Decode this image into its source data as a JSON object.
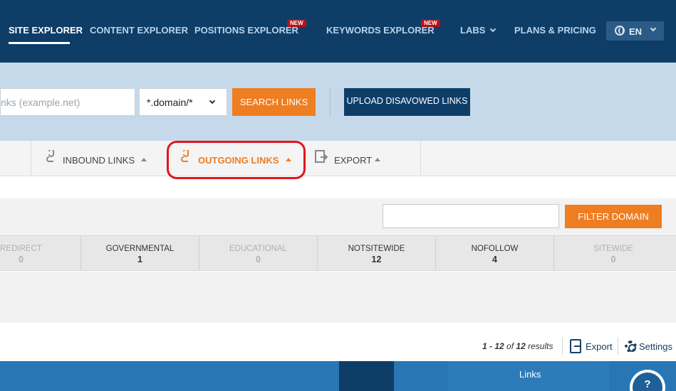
{
  "nav": {
    "items": [
      {
        "label": "SITE EXPLORER"
      },
      {
        "label": "CONTENT EXPLORER"
      },
      {
        "label": "POSITIONS EXPLORER",
        "badge": "NEW"
      },
      {
        "label": "KEYWORDS EXPLORER",
        "badge": "NEW"
      },
      {
        "label": "LABS"
      },
      {
        "label": "PLANS & PRICING"
      }
    ],
    "active": "SITE EXPLORER",
    "language": "EN"
  },
  "search": {
    "url_placeholder": "nks (example.net)",
    "mode_value": "*.domain/*",
    "search_button": "SEARCH LINKS",
    "upload_button": "UPLOAD DISAVOWED LINKS"
  },
  "tabs": [
    {
      "label": "INBOUND LINKS",
      "icon": "link-icon"
    },
    {
      "label": "OUTGOING LINKS",
      "icon": "link-icon",
      "active": true
    },
    {
      "label": "EXPORT",
      "icon": "export-icon"
    }
  ],
  "filter": {
    "input_value": "",
    "button": "FILTER DOMAIN"
  },
  "stats": [
    {
      "name": "REDIRECT",
      "value": "0"
    },
    {
      "name": "GOVERNMENTAL",
      "value": "1"
    },
    {
      "name": "EDUCATIONAL",
      "value": "0"
    },
    {
      "name": "NOTSITEWIDE",
      "value": "12"
    },
    {
      "name": "NOFOLLOW",
      "value": "4"
    },
    {
      "name": "SITEWIDE",
      "value": "0"
    }
  ],
  "results": {
    "range": "1 - 12",
    "of_label": "of",
    "total": "12",
    "suffix": "results",
    "export_label": "Export",
    "settings_label": "Settings"
  },
  "bottom": {
    "label": "Links",
    "help": "?"
  },
  "colors": {
    "nav_bg": "#0e3d68",
    "accent": "#ef7d21",
    "highlight": "#e5141b",
    "search_band": "#c6d9ea"
  }
}
